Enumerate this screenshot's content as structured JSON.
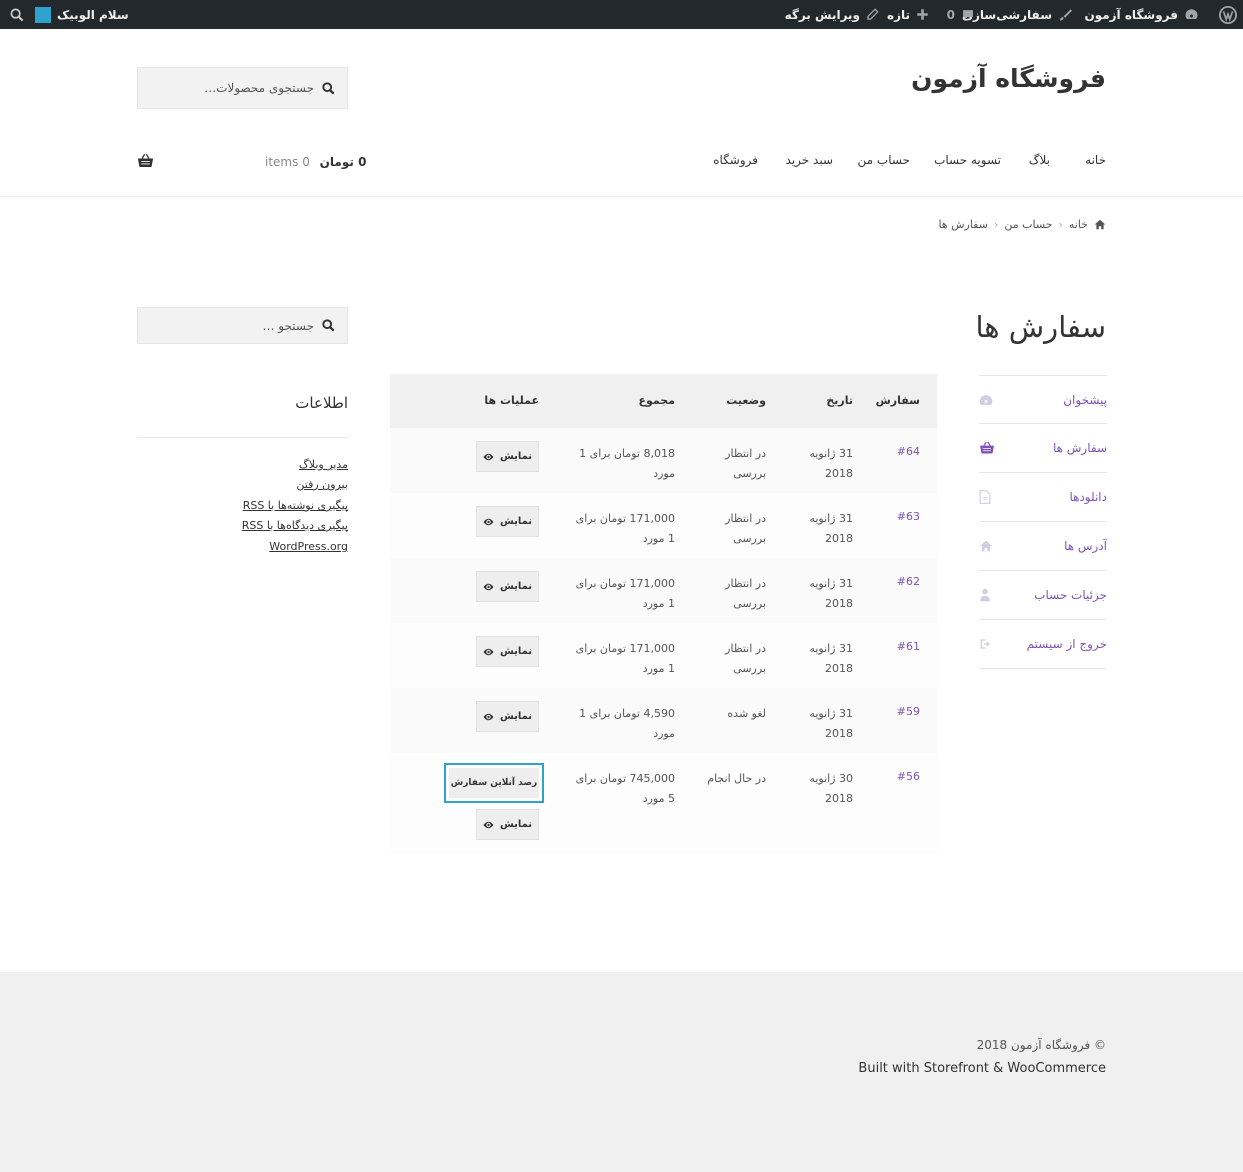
{
  "adminbar": {
    "site_name": "فروشگاه آزمون",
    "customize": "سفارشی‌سازی",
    "comments_count": "0",
    "new": "تازه",
    "edit_page": "ویرایش برگه",
    "greeting": "سلام الوبیک"
  },
  "header": {
    "site_title": "فروشگاه آزمون",
    "product_search_placeholder": "جستجوی محصولات…",
    "nav": [
      "خانه",
      "بلاگ",
      "تسویه حساب",
      "حساب من",
      "سبد خرید",
      "فروشگاه"
    ],
    "cart_amount": "0 تومان",
    "cart_items": "0 items"
  },
  "breadcrumb": [
    "خانه",
    "حساب من",
    "سفارش ها"
  ],
  "page_title": "سفارش ها",
  "account_nav": [
    {
      "label": "پیشخوان",
      "icon": "dashboard-icon"
    },
    {
      "label": "سفارش ها",
      "icon": "basket-icon"
    },
    {
      "label": "دانلودها",
      "icon": "file-icon"
    },
    {
      "label": "آدرس ها",
      "icon": "home-icon"
    },
    {
      "label": "جزئیات حساب",
      "icon": "user-icon"
    },
    {
      "label": "خروج از سیستم",
      "icon": "signout-icon"
    }
  ],
  "orders_table": {
    "headers": {
      "order": "سفارش",
      "date": "تاریخ",
      "status": "وضعیت",
      "total": "مجموع",
      "actions": "عملیات ها"
    },
    "view_label": "نمایش",
    "track_label": "رصد آنلاین سفارش",
    "rows": [
      {
        "number": "#64",
        "date": "31 ژانویه 2018",
        "status": "در انتظار بررسی",
        "total": "8,018 تومان برای 1 مورد"
      },
      {
        "number": "#63",
        "date": "31 ژانویه 2018",
        "status": "در انتظار بررسی",
        "total": "171,000 تومان برای 1 مورد"
      },
      {
        "number": "#62",
        "date": "31 ژانویه 2018",
        "status": "در انتظار بررسی",
        "total": "171,000 تومان برای 1 مورد"
      },
      {
        "number": "#61",
        "date": "31 ژانویه 2018",
        "status": "در انتظار بررسی",
        "total": "171,000 تومان برای 1 مورد"
      },
      {
        "number": "#59",
        "date": "31 ژانویه 2018",
        "status": "لغو شده",
        "total": "4,590 تومان برای 1 مورد"
      },
      {
        "number": "#56",
        "date": "30 ژانویه 2018",
        "status": "در حال انجام",
        "total": "745,000 تومان برای 5 مورد"
      }
    ]
  },
  "sidebar": {
    "search_placeholder": "جستجو …",
    "widget_title": "اطلاعات",
    "links": [
      "مدیر وبلاگ",
      "بیرون رفتن",
      "پیگیری نوشته‌ها با RSS",
      "پیگیری دیدگاه‌ها با RSS",
      "WordPress.org"
    ]
  },
  "footer": {
    "copyright": "© فروشگاه آزمون 2018",
    "built_with": "Built with Storefront & WooCommerce"
  },
  "colors": {
    "accent": "#7f54b3",
    "adminbar": "#23282d",
    "focus": "#2ea2cc"
  }
}
